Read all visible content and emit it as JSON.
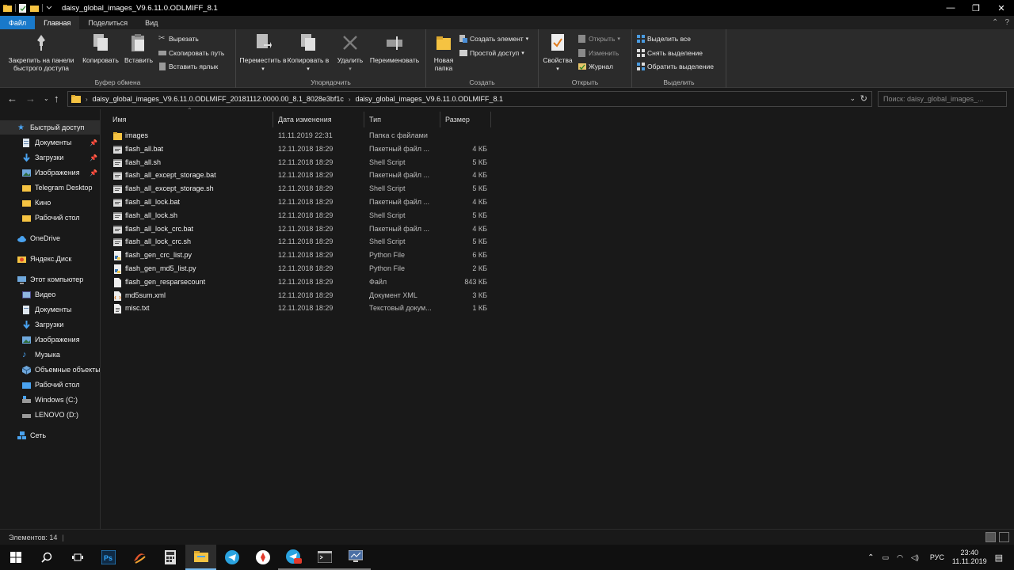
{
  "window": {
    "title": "daisy_global_images_V9.6.11.0.ODLMIFF_8.1",
    "minimize": "—",
    "maximize": "❐",
    "close": "✕"
  },
  "tabs": [
    {
      "label": "Файл"
    },
    {
      "label": "Главная"
    },
    {
      "label": "Поделиться"
    },
    {
      "label": "Вид"
    }
  ],
  "ribbon": {
    "clipboard": {
      "group_label": "Буфер обмена",
      "pin": "Закрепить на панели быстрого доступа",
      "copy": "Копировать",
      "paste": "Вставить",
      "cut": "Вырезать",
      "copy_path": "Скопировать путь",
      "paste_shortcut": "Вставить ярлык"
    },
    "organize": {
      "group_label": "Упорядочить",
      "move": "Переместить в",
      "copy_to": "Копировать в",
      "delete": "Удалить",
      "rename": "Переименовать"
    },
    "create": {
      "group_label": "Создать",
      "new_folder": "Новая папка",
      "new_item": "Создать элемент",
      "easy_access": "Простой доступ"
    },
    "open": {
      "group_label": "Открыть",
      "properties": "Свойства",
      "open": "Открыть",
      "edit": "Изменить",
      "history": "Журнал"
    },
    "select": {
      "group_label": "Выделить",
      "select_all": "Выделить все",
      "select_none": "Снять выделение",
      "invert": "Обратить выделение"
    }
  },
  "address": {
    "crumbs": [
      "daisy_global_images_V9.6.11.0.ODLMIFF_20181112.0000.00_8.1_8028e3bf1c",
      "daisy_global_images_V9.6.11.0.ODLMIFF_8.1"
    ],
    "search_placeholder": "Поиск: daisy_global_images_..."
  },
  "nav": {
    "items": [
      {
        "label": "Быстрый доступ",
        "icon": "star-icon",
        "pinned": false
      },
      {
        "label": "Документы",
        "icon": "documents-icon",
        "pinned": true
      },
      {
        "label": "Загрузки",
        "icon": "downloads-icon",
        "pinned": true
      },
      {
        "label": "Изображения",
        "icon": "pictures-icon",
        "pinned": true
      },
      {
        "label": "Telegram Desktop",
        "icon": "folder-icon",
        "pinned": false
      },
      {
        "label": "Кино",
        "icon": "folder-icon",
        "pinned": false
      },
      {
        "label": "Рабочий стол",
        "icon": "folder-icon",
        "pinned": false
      },
      {
        "label": "OneDrive",
        "icon": "cloud-icon",
        "pinned": false
      },
      {
        "label": "Яндекс.Диск",
        "icon": "yandex-disk-icon",
        "pinned": false
      },
      {
        "label": "Этот компьютер",
        "icon": "computer-icon",
        "pinned": false
      },
      {
        "label": "Видео",
        "icon": "video-icon",
        "pinned": false
      },
      {
        "label": "Документы",
        "icon": "documents-icon",
        "pinned": false
      },
      {
        "label": "Загрузки",
        "icon": "downloads-icon",
        "pinned": false
      },
      {
        "label": "Изображения",
        "icon": "pictures-icon",
        "pinned": false
      },
      {
        "label": "Музыка",
        "icon": "music-icon",
        "pinned": false
      },
      {
        "label": "Объемные объекты",
        "icon": "3d-objects-icon",
        "pinned": false
      },
      {
        "label": "Рабочий стол",
        "icon": "desktop-icon",
        "pinned": false
      },
      {
        "label": "Windows (C:)",
        "icon": "drive-icon",
        "pinned": false
      },
      {
        "label": "LENOVO (D:)",
        "icon": "drive-icon",
        "pinned": false
      },
      {
        "label": "Сеть",
        "icon": "network-icon",
        "pinned": false
      }
    ]
  },
  "columns": {
    "name": "Имя",
    "date": "Дата изменения",
    "type": "Тип",
    "size": "Размер"
  },
  "files": [
    {
      "name": "images",
      "date": "11.11.2019 22:31",
      "type": "Папка с файлами",
      "size": "",
      "kind": "folder"
    },
    {
      "name": "flash_all.bat",
      "date": "12.11.2018 18:29",
      "type": "Пакетный файл ...",
      "size": "4 КБ",
      "kind": "bat"
    },
    {
      "name": "flash_all.sh",
      "date": "12.11.2018 18:29",
      "type": "Shell Script",
      "size": "5 КБ",
      "kind": "sh"
    },
    {
      "name": "flash_all_except_storage.bat",
      "date": "12.11.2018 18:29",
      "type": "Пакетный файл ...",
      "size": "4 КБ",
      "kind": "bat"
    },
    {
      "name": "flash_all_except_storage.sh",
      "date": "12.11.2018 18:29",
      "type": "Shell Script",
      "size": "5 КБ",
      "kind": "sh"
    },
    {
      "name": "flash_all_lock.bat",
      "date": "12.11.2018 18:29",
      "type": "Пакетный файл ...",
      "size": "4 КБ",
      "kind": "bat"
    },
    {
      "name": "flash_all_lock.sh",
      "date": "12.11.2018 18:29",
      "type": "Shell Script",
      "size": "5 КБ",
      "kind": "sh"
    },
    {
      "name": "flash_all_lock_crc.bat",
      "date": "12.11.2018 18:29",
      "type": "Пакетный файл ...",
      "size": "4 КБ",
      "kind": "bat"
    },
    {
      "name": "flash_all_lock_crc.sh",
      "date": "12.11.2018 18:29",
      "type": "Shell Script",
      "size": "5 КБ",
      "kind": "sh"
    },
    {
      "name": "flash_gen_crc_list.py",
      "date": "12.11.2018 18:29",
      "type": "Python File",
      "size": "6 КБ",
      "kind": "py"
    },
    {
      "name": "flash_gen_md5_list.py",
      "date": "12.11.2018 18:29",
      "type": "Python File",
      "size": "2 КБ",
      "kind": "py"
    },
    {
      "name": "flash_gen_resparsecount",
      "date": "12.11.2018 18:29",
      "type": "Файл",
      "size": "843 КБ",
      "kind": "file"
    },
    {
      "name": "md5sum.xml",
      "date": "12.11.2018 18:29",
      "type": "Документ XML",
      "size": "3 КБ",
      "kind": "xml"
    },
    {
      "name": "misc.txt",
      "date": "12.11.2018 18:29",
      "type": "Текстовый докум...",
      "size": "1 КБ",
      "kind": "txt"
    }
  ],
  "status": {
    "items_count": "Элементов: 14"
  },
  "taskbar": {
    "lang": "РУС",
    "time": "23:40",
    "date": "11.11.2019",
    "apps": [
      "start-icon",
      "search-icon",
      "task-view-icon",
      "photoshop-icon",
      "app-swirl-icon",
      "calculator-icon",
      "file-explorer-icon",
      "telegram-icon",
      "yandex-browser-icon",
      "telegram-badge-icon",
      "terminal-icon",
      "monitor-app-icon"
    ]
  },
  "colors": {
    "accent": "#1979ca",
    "folder": "#f5c342",
    "background": "#191919"
  }
}
